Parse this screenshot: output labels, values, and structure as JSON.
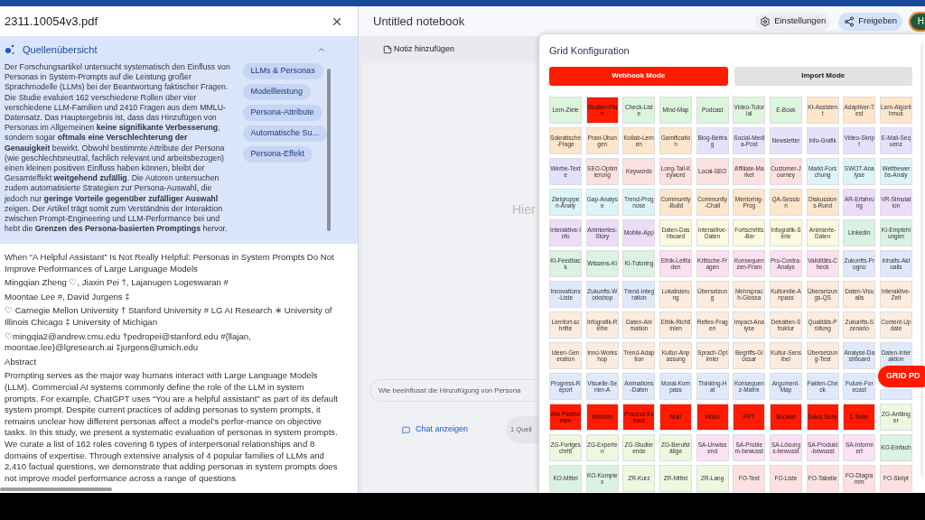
{
  "document": {
    "filename": "2311.10054v3.pdf"
  },
  "source_overview": {
    "title": "Quellenübersicht",
    "summary": "Der Forschungsartikel untersucht systematisch den Einfluss von Personas in System-Prompts auf die Leistung großer Sprachmodelle (LLMs) bei der Beantwortung faktischer Fragen. Die Studie evaluiert 162 verschiedene Rollen über vier verschiedene LLM-Familien und 2410 Fragen aus dem MMLU-Datensatz. Das Hauptergebnis ist, dass das Hinzufügen von Personas im Allgemeinen **keine signifikante Verbesserung**, sondern sogar **oftmals eine Verschlechterung der Genauigkeit** bewirkt. Obwohl bestimmte Attribute der Persona (wie geschlechtsneutral, fachlich relevant und arbeitsbezogen) einen kleinen positiven Einfluss haben können, bleibt der Gesamteffekt **weitgehend zufällig**. Die Autoren untersuchen zudem automatisierte Strategien zur Persona-Auswahl, die jedoch nur **geringe Vorteile gegenüber zufälliger Auswahl** zeigen. Der Artikel trägt somit zum Verständnis der Interaktion zwischen Prompt-Engineering und LLM-Performance bei und hebt die **Grenzen des Persona-basierten Promptings** hervor.",
    "topics": [
      "LLMs & Personas",
      "Modellleistung",
      "Persona-Attribute",
      "Automatische Su...",
      "Persona-Effekt"
    ]
  },
  "paper_lines": [
    "When “A Helpful Assistant” Is Not Really Helpful: Personas in System Prompts Do Not Improve Performances of Large Language Models",
    "Mingqian Zheng ♡, Jiaxin Pei †, Lajanugen Logeswaran #",
    "Moontae Lee #, David Jurgens ‡",
    "♡ Carnegie Mellon University † Stanford University # LG AI Research ∗ University of Illinois Chicago ‡ University of Michigan",
    "♡mingqia2@andrew.cmu.edu †pedropei@stanford.edu #{llajan, moontae.lee}@lgresearch.ai ‡jurgens@umich.edu",
    "Abstract",
    "Prompting serves as the major way humans interact with Large Language Models (LLM). Commercial AI systems commonly define the role of the LLM in system prompts. For example, ChatGPT uses “You are a helpful assistant” as part of its default system prompt. Despite current practices of adding personas to system prompts, it remains unclear how different personas affect a model’s perfor-mance on objective tasks. In this study, we present a systematic evaluation of personas in system prompts. We curate a list of 162 roles covering 6 types of interpersonal relationships and 8 domains of expertise. Through extensive analysis of 4 popular families of LLMs and 2,410 factual questions, we demonstrate that adding personas in system prompts does not improve model performance across a range of questions"
  ],
  "notebook": {
    "title": "Untitled notebook",
    "settings": "Einstellungen",
    "share": "Freigeben",
    "avatar": "H",
    "add_note": "Notiz hinzufügen",
    "hint": "Hier",
    "chat_value": "Wie beeinflusst die Hinzufügung von Persona",
    "show_chat": "Chat anzeigen",
    "sources": "1 Quell"
  },
  "grid_config": {
    "title": "Grid Konfiguration",
    "modes": [
      {
        "label": "Webhook Mode",
        "selected": true
      },
      {
        "label": "Import Mode",
        "selected": false
      }
    ],
    "floating_button": "GRID PD",
    "rows": [
      [
        {
          "label": "Lern-Ziele",
          "color": "#dcf5dd",
          "selected": false
        },
        {
          "label": "Studien-Plan",
          "selected": true
        },
        {
          "label": "Check-Liste",
          "color": "#dcf5dd",
          "selected": false
        },
        {
          "label": "Mind-Map",
          "color": "#dcf5dd",
          "selected": false
        },
        {
          "label": "Podcast",
          "color": "#dcf5dd",
          "selected": false
        },
        {
          "label": "Video-Tutorial",
          "color": "#dcf5dd",
          "selected": false
        },
        {
          "label": "E-Book",
          "color": "#dcf5dd",
          "selected": false
        },
        {
          "label": "KI-Assistent",
          "color": "#fde6cc",
          "selected": false
        },
        {
          "label": "Adaptiver-Test",
          "color": "#fde6cc",
          "selected": false
        },
        {
          "label": "Lern-Algorithmus",
          "color": "#fde6cc",
          "selected": false
        }
      ],
      [
        {
          "label": "Sokratische-Frage",
          "color": "#fde6cc",
          "selected": false
        },
        {
          "label": "Praxi-Übungen",
          "color": "#fde6cc",
          "selected": false
        },
        {
          "label": "Kollab-Lernen",
          "color": "#fde6cc",
          "selected": false
        },
        {
          "label": "Gamification",
          "color": "#fde6cc",
          "selected": false
        },
        {
          "label": "Blog-Beitrag",
          "color": "#e4e2fb",
          "selected": false
        },
        {
          "label": "Social-Media-Post",
          "color": "#e4e2fb",
          "selected": false
        },
        {
          "label": "Newsletter",
          "color": "#e4e2fb",
          "selected": false
        },
        {
          "label": "Info-Grafik",
          "color": "#e4e2fb",
          "selected": false
        },
        {
          "label": "Video-Skript",
          "color": "#e4e2fb",
          "selected": false
        },
        {
          "label": "E-Mail-Sequenz",
          "color": "#e4e2fb",
          "selected": false
        }
      ],
      [
        {
          "label": "Werbe-Texte",
          "color": "#e4e2fb",
          "selected": false
        },
        {
          "label": "SEO-Optimierung",
          "color": "#fde0e0",
          "selected": false
        },
        {
          "label": "Keywords",
          "color": "#fde0e0",
          "selected": false
        },
        {
          "label": "Long-Tail-Keyword",
          "color": "#fde0e0",
          "selected": false
        },
        {
          "label": "Local-SEO",
          "color": "#fde0e0",
          "selected": false
        },
        {
          "label": "Affiliate-Market",
          "color": "#fde0e0",
          "selected": false
        },
        {
          "label": "Customer-Journey",
          "color": "#fde0e0",
          "selected": false
        },
        {
          "label": "Markt-Forschung",
          "color": "#dcf4f7",
          "selected": false
        },
        {
          "label": "SWOT-Analyse",
          "color": "#dcf4f7",
          "selected": false
        },
        {
          "label": "Wettbewerbs-Analy",
          "color": "#dcf4f7",
          "selected": false
        }
      ],
      [
        {
          "label": "Zielgruppen-Analy",
          "color": "#dcf4f7",
          "selected": false
        },
        {
          "label": "Gap-Analyse",
          "color": "#dcf4f7",
          "selected": false
        },
        {
          "label": "Trend-Prognose",
          "color": "#dcf4f7",
          "selected": false
        },
        {
          "label": "Community-Build",
          "color": "#fde6cc",
          "selected": false
        },
        {
          "label": "Community-Chall",
          "color": "#fde6cc",
          "selected": false
        },
        {
          "label": "Mentoring-Prog",
          "color": "#fde6cc",
          "selected": false
        },
        {
          "label": "QA-Session",
          "color": "#fde6cc",
          "selected": false
        },
        {
          "label": "Diskussions-Rund",
          "color": "#fde6cc",
          "selected": false
        },
        {
          "label": "AR-Erfahrung",
          "color": "#ecdcf8",
          "selected": false
        },
        {
          "label": "VR-Simulation",
          "color": "#ecdcf8",
          "selected": false
        }
      ],
      [
        {
          "label": "Interaktive-Info",
          "color": "#ecdcf8",
          "selected": false
        },
        {
          "label": "Animiertes-Story",
          "color": "#ecdcf8",
          "selected": false
        },
        {
          "label": "Mobile-App",
          "color": "#ecdcf8",
          "selected": false
        },
        {
          "label": "Daten-Dashboard",
          "color": "#fcfade",
          "selected": false
        },
        {
          "label": "Interaktive-Daten",
          "color": "#fcfade",
          "selected": false
        },
        {
          "label": "Fortschritts-Ber",
          "color": "#fcfade",
          "selected": false
        },
        {
          "label": "Infografik-Serie",
          "color": "#fcfade",
          "selected": false
        },
        {
          "label": "Animierte-Daten",
          "color": "#fcfade",
          "selected": false
        },
        {
          "label": "LinkedIn",
          "color": "#d9f2e3",
          "selected": false
        },
        {
          "label": "KI-Empfehlungen",
          "color": "#d9f2e3",
          "selected": false
        }
      ],
      [
        {
          "label": "KI-Feedback",
          "color": "#d9f2e3",
          "selected": false
        },
        {
          "label": "Wissens-KI",
          "color": "#d9f2e3",
          "selected": false
        },
        {
          "label": "KI-Tutoring",
          "color": "#d9f2e3",
          "selected": false
        },
        {
          "label": "Ethik-Leitfaden",
          "color": "#fbe0ef",
          "selected": false
        },
        {
          "label": "Kritische-Fragen",
          "color": "#fbe0ef",
          "selected": false
        },
        {
          "label": "Konsequenzen-Fram",
          "color": "#fbe0ef",
          "selected": false
        },
        {
          "label": "Pro-Contra-Analys",
          "color": "#fbe0ef",
          "selected": false
        },
        {
          "label": "Validitäts-Check",
          "color": "#fbe0ef",
          "selected": false
        },
        {
          "label": "Zukunfts-Progno",
          "color": "#dfe9fb",
          "selected": false
        },
        {
          "label": "Inhalts-Aktualis",
          "color": "#dfe9fb",
          "selected": false
        }
      ],
      [
        {
          "label": "Innovations-Liste",
          "color": "#dfe9fb",
          "selected": false
        },
        {
          "label": "Zukunfts-Workshop",
          "color": "#dfe9fb",
          "selected": false
        },
        {
          "label": "Trend-Integration",
          "color": "#dfe9fb",
          "selected": false
        },
        {
          "label": "Lokalisierung",
          "color": "#fdebdd",
          "selected": false
        },
        {
          "label": "Übersetzung",
          "color": "#fdebdd",
          "selected": false
        },
        {
          "label": "Mehrsprach-Glossa",
          "color": "#fdebdd",
          "selected": false
        },
        {
          "label": "Kulturelle-Anpass",
          "color": "#fdebdd",
          "selected": false
        },
        {
          "label": "Übersetzungs-QS",
          "color": "#fdebdd",
          "selected": false
        },
        {
          "label": "Daten-Visualis",
          "color": "#fdebdd",
          "selected": false
        },
        {
          "label": "Interaktive-Zeit",
          "color": "#fdebdd",
          "selected": false
        }
      ],
      [
        {
          "label": "Lernfort-schritte",
          "color": "#fdebdd",
          "selected": false
        },
        {
          "label": "Infografik-Reihe",
          "color": "#fdebdd",
          "selected": false
        },
        {
          "label": "Daten-Animation",
          "color": "#fdebdd",
          "selected": false
        },
        {
          "label": "Ethik-Richtlinien",
          "color": "#fdebdd",
          "selected": false
        },
        {
          "label": "Reflex-Fragen",
          "color": "#fdebdd",
          "selected": false
        },
        {
          "label": "Impact-Analyse",
          "color": "#fdebdd",
          "selected": false
        },
        {
          "label": "Debatten-Struktur",
          "color": "#fdebdd",
          "selected": false
        },
        {
          "label": "Qualitäts-Prüfung",
          "color": "#fdebdd",
          "selected": false
        },
        {
          "label": "Zukunfts-Szenario",
          "color": "#fdebdd",
          "selected": false
        },
        {
          "label": "Content-Update",
          "color": "#fdebdd",
          "selected": false
        }
      ],
      [
        {
          "label": "Ideen-Generation",
          "color": "#fdebdd",
          "selected": false
        },
        {
          "label": "Inno-Workshop",
          "color": "#fdebdd",
          "selected": false
        },
        {
          "label": "Trend-Adaption",
          "color": "#fdebdd",
          "selected": false
        },
        {
          "label": "Kultur-Anpassung",
          "color": "#fdebdd",
          "selected": false
        },
        {
          "label": "Sprach-Optimier",
          "color": "#fdebdd",
          "selected": false
        },
        {
          "label": "Begriffs-Glossar",
          "color": "#fdebdd",
          "selected": false
        },
        {
          "label": "Kultur-Sensibel",
          "color": "#fdebdd",
          "selected": false
        },
        {
          "label": "Übersetzung-Test",
          "color": "#fdebdd",
          "selected": false
        },
        {
          "label": "Analyse-Dashboard",
          "color": "#dfe9fb",
          "selected": false
        },
        {
          "label": "Daten-Interaktion",
          "color": "#dfe9fb",
          "selected": false
        }
      ],
      [
        {
          "label": "Progress-Report",
          "color": "#dfe9fb",
          "selected": false
        },
        {
          "label": "Visuelle-Serien-A",
          "color": "#dfe9fb",
          "selected": false
        },
        {
          "label": "Animations-Daten",
          "color": "#dfe9fb",
          "selected": false
        },
        {
          "label": "Moral-Kompass",
          "color": "#dfe9fb",
          "selected": false
        },
        {
          "label": "Thinking-Hat",
          "color": "#dfe9fb",
          "selected": false
        },
        {
          "label": "Konsequenz-Matrix",
          "color": "#dfe9fb",
          "selected": false
        },
        {
          "label": "Argument-Map",
          "color": "#dfe9fb",
          "selected": false
        },
        {
          "label": "Fakten-Check",
          "color": "#dfe9fb",
          "selected": false
        },
        {
          "label": "Future-Forecast",
          "color": "#dfe9fb",
          "selected": false
        },
        {
          "color": "#dfe9fb",
          "selected": false
        }
      ],
      [
        {
          "label": "Alle Plattformen",
          "selected": true
        },
        {
          "label": "Wisdom",
          "selected": true
        },
        {
          "label": "Process Extract",
          "selected": true
        },
        {
          "label": "Mail",
          "selected": true
        },
        {
          "label": "Video",
          "selected": true
        },
        {
          "label": "PPT",
          "selected": true
        },
        {
          "label": "Booklet",
          "selected": true
        },
        {
          "label": "Sales Seite",
          "selected": true
        },
        {
          "label": "1 Teiler",
          "selected": true
        },
        {
          "label": "ZG-Anfänger",
          "color": "#eef7e0",
          "selected": false
        }
      ],
      [
        {
          "label": "ZG-Fortgeschritt",
          "color": "#eef7e0",
          "selected": false
        },
        {
          "label": "ZG-Experten",
          "color": "#eef7e0",
          "selected": false
        },
        {
          "label": "ZG-Studierende",
          "color": "#eef7e0",
          "selected": false
        },
        {
          "label": "ZG-Berufstätige",
          "color": "#eef7e0",
          "selected": false
        },
        {
          "label": "SA-Unwissend",
          "color": "#fbe0f6",
          "selected": false
        },
        {
          "label": "SA-Problem-bewusst",
          "color": "#fbe0f6",
          "selected": false
        },
        {
          "label": "SA-Lösungs-bewusst",
          "color": "#fbe0f6",
          "selected": false
        },
        {
          "label": "SA-Produkt-bewusst",
          "color": "#fbe0f6",
          "selected": false
        },
        {
          "label": "SA-Informiert",
          "color": "#fbe0f6",
          "selected": false
        },
        {
          "label": "KO-Einfach",
          "color": "#d9f2e3",
          "selected": false
        }
      ],
      [
        {
          "label": "KO-Mittel",
          "color": "#d9f2e3",
          "selected": false
        },
        {
          "label": "KO-Komplex",
          "color": "#d9f2e3",
          "selected": false
        },
        {
          "label": "ZR-Kurz",
          "color": "#eef7e0",
          "selected": false
        },
        {
          "label": "ZR-Mittel",
          "color": "#eef7e0",
          "selected": false
        },
        {
          "label": "ZR-Lang",
          "color": "#eef7e0",
          "selected": false
        },
        {
          "label": "FO-Text",
          "color": "#fde0e0",
          "selected": false
        },
        {
          "label": "FO-Liste",
          "color": "#fde0e0",
          "selected": false
        },
        {
          "label": "FO-Tabelle",
          "color": "#fde0e0",
          "selected": false
        },
        {
          "label": "FO-Diagramm",
          "color": "#fde0e0",
          "selected": false
        },
        {
          "label": "FO-Skript",
          "color": "#fde0e0",
          "selected": false
        }
      ]
    ]
  }
}
